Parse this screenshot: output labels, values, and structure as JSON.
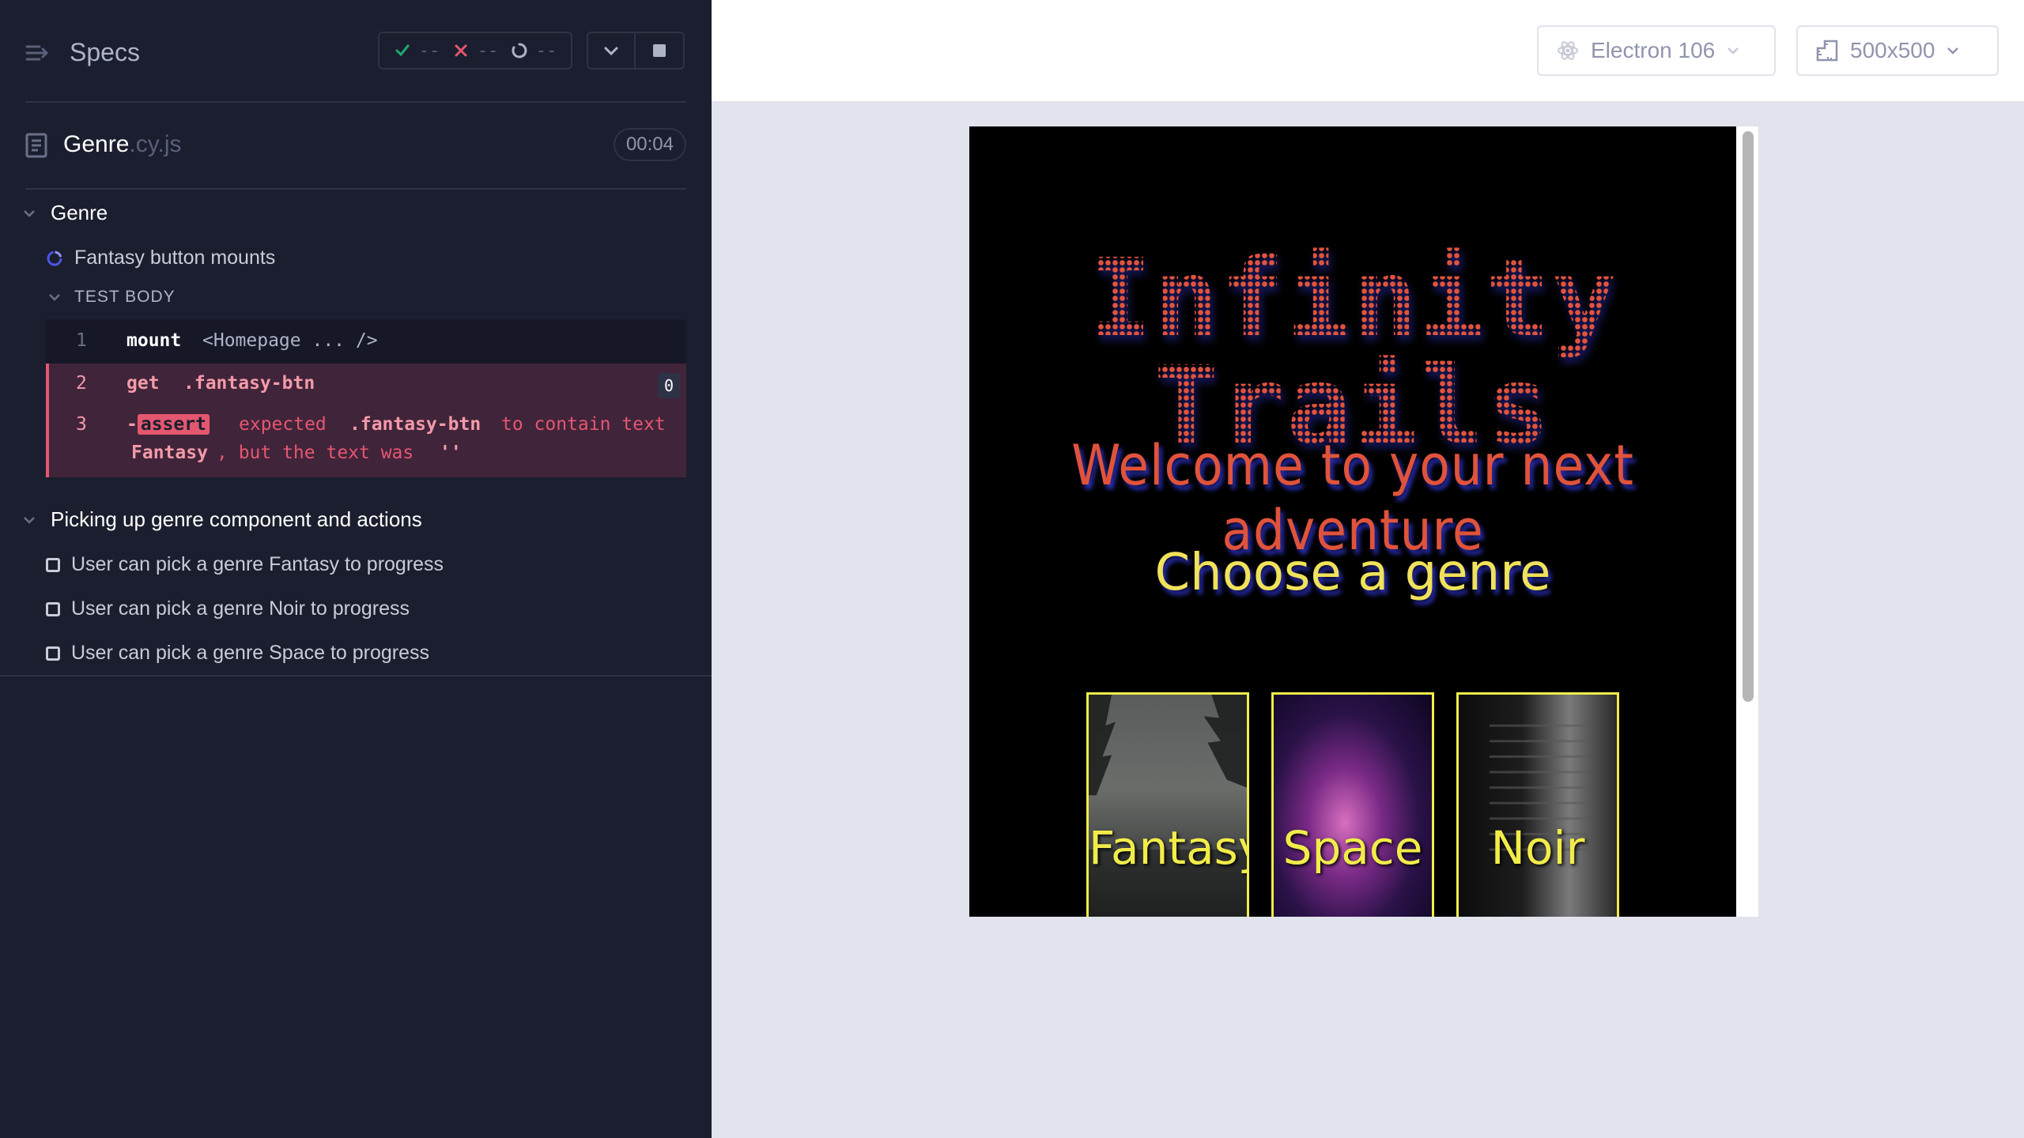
{
  "reporter": {
    "title": "Specs",
    "stats": {
      "passed": "--",
      "failed": "--",
      "pending": "--"
    },
    "spec_file": {
      "base": "Genre",
      "ext": ".cy.js",
      "duration": "00:04"
    },
    "suites": [
      {
        "title": "Genre",
        "tests": [
          {
            "title": "Fantasy button mounts",
            "state": "running",
            "body_label": "TEST BODY",
            "commands": [
              {
                "num": "1",
                "name": "mount",
                "message": "<Homepage ... />"
              },
              {
                "num": "2",
                "name": "get",
                "message": ".fantasy-btn",
                "count": "0"
              },
              {
                "num": "3",
                "name": "-assert",
                "message_parts": [
                  "expected",
                  ".fantasy-btn",
                  "to contain text",
                  "Fantasy",
                  ", but the text was",
                  "''"
                ]
              }
            ]
          }
        ]
      },
      {
        "title": "Picking up genre component and actions",
        "tests": [
          {
            "title": "User can pick a genre Fantasy to progress",
            "state": "pending"
          },
          {
            "title": "User can pick a genre Noir to progress",
            "state": "pending"
          },
          {
            "title": "User can pick a genre Space to progress",
            "state": "pending"
          }
        ]
      }
    ]
  },
  "aut_header": {
    "browser": "Electron 106",
    "viewport": "500x500"
  },
  "game": {
    "title": "Infinity Trails",
    "subtitle": "Welcome to your next adventure",
    "prompt": "Choose a genre",
    "genres": [
      "Fantasy",
      "Space",
      "Noir"
    ]
  },
  "colors": {
    "reporter_bg": "#1b1e2e",
    "fail_red": "#e45770",
    "title_red": "#e0533b",
    "genre_yellow": "#f2ec4a",
    "pass_green": "#1fa971"
  }
}
